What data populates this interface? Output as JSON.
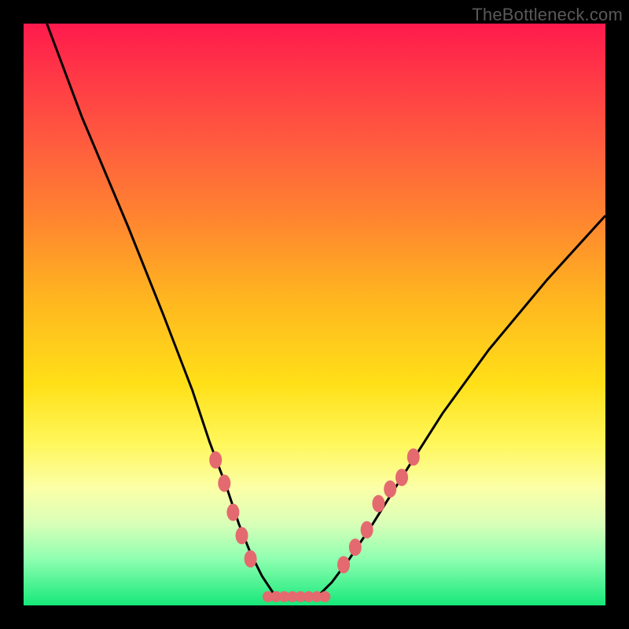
{
  "watermark": "TheBottleneck.com",
  "chart_data": {
    "type": "line",
    "title": "",
    "xlabel": "",
    "ylabel": "",
    "xlim": [
      0,
      100
    ],
    "ylim": [
      0,
      100
    ],
    "series": [
      {
        "name": "bottleneck-curve",
        "x": [
          4,
          10,
          18,
          24,
          29,
          32,
          35,
          37,
          39,
          41,
          43,
          45,
          47,
          49,
          51,
          53,
          56,
          60,
          65,
          72,
          80,
          90,
          100
        ],
        "y": [
          100,
          84,
          65,
          50,
          37,
          28,
          20,
          14,
          9,
          5,
          2,
          1,
          1,
          1,
          2,
          4,
          8,
          14,
          22,
          33,
          44,
          56,
          67
        ]
      }
    ],
    "markers": {
      "name": "highlight-dots",
      "color": "#e46a6f",
      "points": [
        {
          "x": 33,
          "y": 25
        },
        {
          "x": 34.5,
          "y": 21
        },
        {
          "x": 36,
          "y": 16
        },
        {
          "x": 37.5,
          "y": 12
        },
        {
          "x": 39,
          "y": 8
        },
        {
          "x": 55,
          "y": 7
        },
        {
          "x": 57,
          "y": 10
        },
        {
          "x": 59,
          "y": 13
        },
        {
          "x": 61,
          "y": 17.5
        },
        {
          "x": 63,
          "y": 20
        },
        {
          "x": 65,
          "y": 22
        },
        {
          "x": 67,
          "y": 25.5
        }
      ],
      "trough_band": {
        "x0": 42,
        "x1": 52,
        "y": 1.5
      }
    },
    "gradient_stops": [
      {
        "pos": 0,
        "color": "#ff1a4d"
      },
      {
        "pos": 8,
        "color": "#ff3547"
      },
      {
        "pos": 20,
        "color": "#ff5a3f"
      },
      {
        "pos": 35,
        "color": "#ff8a2e"
      },
      {
        "pos": 48,
        "color": "#ffb81f"
      },
      {
        "pos": 62,
        "color": "#ffe018"
      },
      {
        "pos": 72,
        "color": "#fff75a"
      },
      {
        "pos": 80,
        "color": "#fbffa8"
      },
      {
        "pos": 86,
        "color": "#d8ffb8"
      },
      {
        "pos": 92,
        "color": "#8fffb0"
      },
      {
        "pos": 100,
        "color": "#16e87a"
      }
    ]
  }
}
